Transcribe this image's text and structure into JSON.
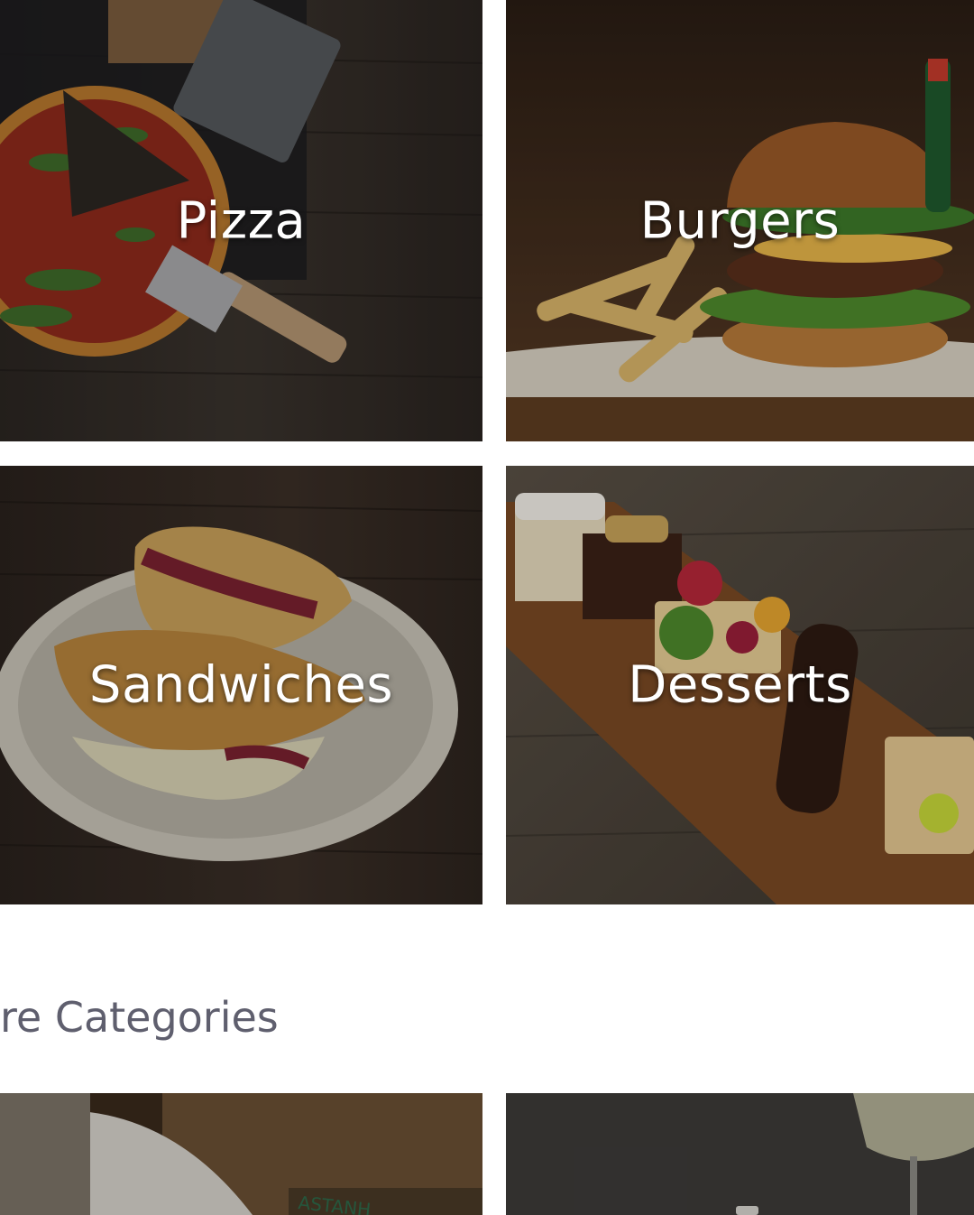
{
  "categories": [
    {
      "label": "Pizza"
    },
    {
      "label": "Burgers"
    },
    {
      "label": "Sandwiches"
    },
    {
      "label": "Desserts"
    }
  ],
  "more_section": {
    "title": "re Categories"
  },
  "colors": {
    "background": "#ffffff",
    "section_title": "#5f5f6e",
    "tile_label": "#ffffff"
  }
}
